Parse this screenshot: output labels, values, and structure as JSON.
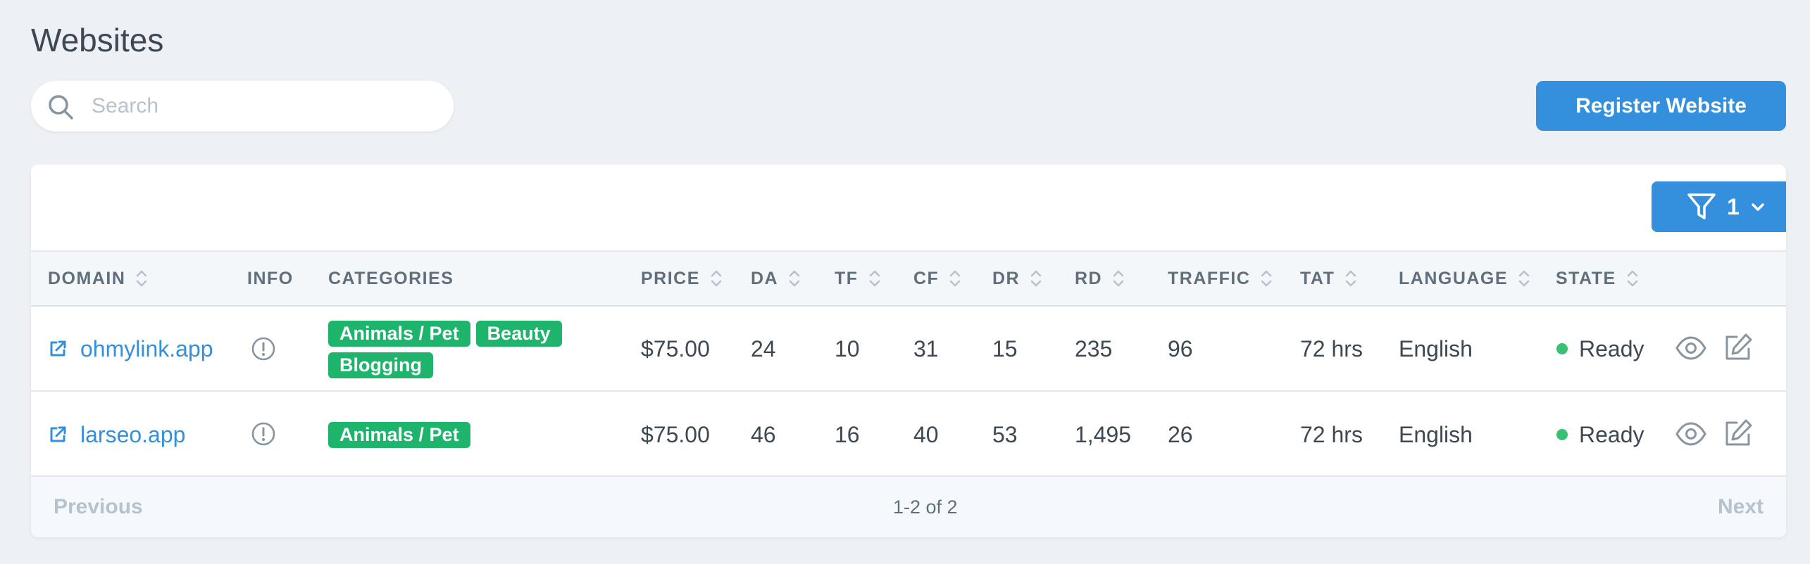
{
  "page": {
    "title": "Websites"
  },
  "search": {
    "placeholder": "Search",
    "value": ""
  },
  "toolbar": {
    "register_label": "Register Website"
  },
  "filter": {
    "count": "1"
  },
  "table": {
    "columns": [
      "DOMAIN",
      "INFO",
      "CATEGORIES",
      "PRICE",
      "DA",
      "TF",
      "CF",
      "DR",
      "RD",
      "TRAFFIC",
      "TAT",
      "LANGUAGE",
      "STATE"
    ],
    "rows": [
      {
        "domain": "ohmylink.app",
        "categories": [
          "Animals / Pet",
          "Beauty",
          "Blogging"
        ],
        "price": "$75.00",
        "da": "24",
        "tf": "10",
        "cf": "31",
        "dr": "15",
        "rd": "235",
        "traffic": "96",
        "tat": "72 hrs",
        "language": "English",
        "state": "Ready"
      },
      {
        "domain": "larseo.app",
        "categories": [
          "Animals / Pet"
        ],
        "price": "$75.00",
        "da": "46",
        "tf": "16",
        "cf": "40",
        "dr": "53",
        "rd": "1,495",
        "traffic": "26",
        "tat": "72 hrs",
        "language": "English",
        "state": "Ready"
      }
    ]
  },
  "pagination": {
    "previous": "Previous",
    "info": "1-2 of 2",
    "next": "Next"
  },
  "colors": {
    "accent": "#3490dc",
    "badge": "#1fb46b",
    "ready_dot": "#38c172"
  },
  "icons": [
    "search-icon",
    "filter-icon",
    "chevron-down-icon",
    "sort-icon",
    "external-link-icon",
    "info-icon",
    "eye-icon",
    "edit-icon"
  ]
}
